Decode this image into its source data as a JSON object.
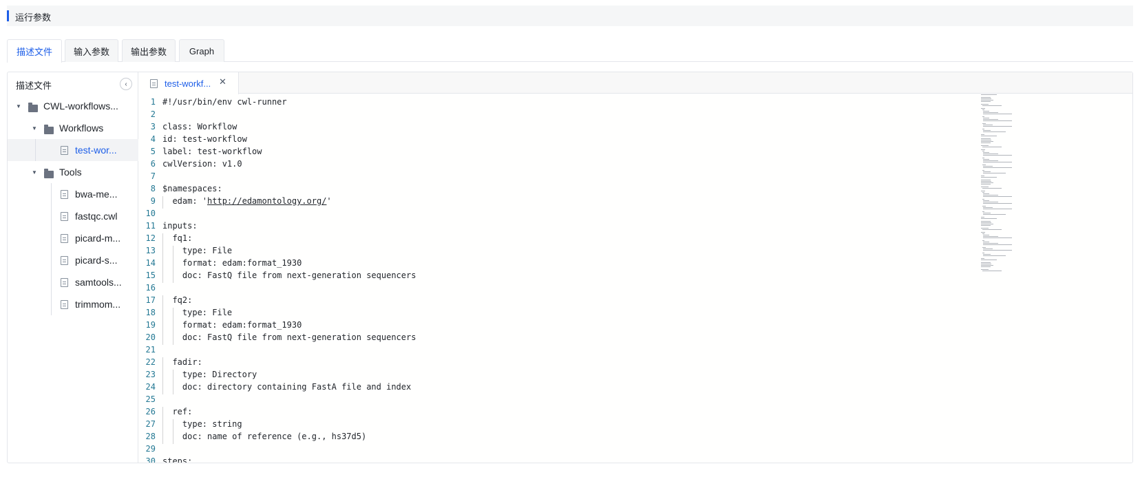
{
  "section": {
    "title": "运行参数"
  },
  "tabs": [
    {
      "label": "描述文件",
      "active": true
    },
    {
      "label": "输入参数",
      "active": false
    },
    {
      "label": "输出参数",
      "active": false
    },
    {
      "label": "Graph",
      "active": false
    }
  ],
  "tree": {
    "title": "描述文件",
    "collapse_icon": "chevron-left-icon",
    "root": "CWL-workflows...",
    "workflows_folder": "Workflows",
    "workflow_file": "test-wor...",
    "tools_folder": "Tools",
    "tool_files": [
      "bwa-me...",
      "fastqc.cwl",
      "picard-m...",
      "picard-s...",
      "samtools...",
      "trimmom..."
    ]
  },
  "editor": {
    "open_tab": "test-workf...",
    "close_glyph": "✕",
    "lines": [
      {
        "n": "1",
        "text": "#!/usr/bin/env cwl-runner"
      },
      {
        "n": "2",
        "text": ""
      },
      {
        "n": "3",
        "text": "class: Workflow"
      },
      {
        "n": "4",
        "text": "id: test-workflow"
      },
      {
        "n": "5",
        "text": "label: test-workflow"
      },
      {
        "n": "6",
        "text": "cwlVersion: v1.0"
      },
      {
        "n": "7",
        "text": ""
      },
      {
        "n": "8",
        "text": "$namespaces:"
      },
      {
        "n": "9",
        "text": "  edam: 'http://edamontology.org/'"
      },
      {
        "n": "10",
        "text": ""
      },
      {
        "n": "11",
        "text": "inputs:"
      },
      {
        "n": "12",
        "text": "  fq1:"
      },
      {
        "n": "13",
        "text": "    type: File"
      },
      {
        "n": "14",
        "text": "    format: edam:format_1930"
      },
      {
        "n": "15",
        "text": "    doc: FastQ file from next-generation sequencers"
      },
      {
        "n": "16",
        "text": ""
      },
      {
        "n": "17",
        "text": "  fq2:"
      },
      {
        "n": "18",
        "text": "    type: File"
      },
      {
        "n": "19",
        "text": "    format: edam:format_1930"
      },
      {
        "n": "20",
        "text": "    doc: FastQ file from next-generation sequencers"
      },
      {
        "n": "21",
        "text": ""
      },
      {
        "n": "22",
        "text": "  fadir:"
      },
      {
        "n": "23",
        "text": "    type: Directory"
      },
      {
        "n": "24",
        "text": "    doc: directory containing FastA file and index"
      },
      {
        "n": "25",
        "text": ""
      },
      {
        "n": "26",
        "text": "  ref:"
      },
      {
        "n": "27",
        "text": "    type: string"
      },
      {
        "n": "28",
        "text": "    doc: name of reference (e.g., hs37d5)"
      },
      {
        "n": "29",
        "text": ""
      },
      {
        "n": "30",
        "text": "steps:"
      }
    ]
  },
  "colors": {
    "accent": "#1d5ee8",
    "line_number": "#237893"
  }
}
